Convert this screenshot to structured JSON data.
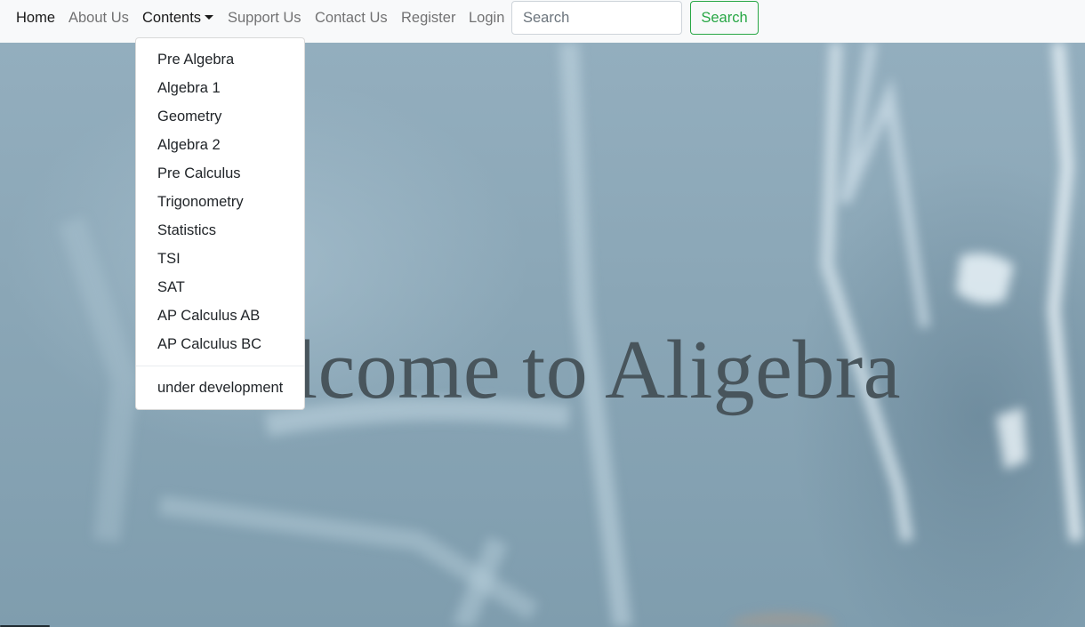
{
  "nav": {
    "links": [
      {
        "label": "Home"
      },
      {
        "label": "About Us"
      },
      {
        "label": "Contents"
      },
      {
        "label": "Support Us"
      },
      {
        "label": "Contact Us"
      },
      {
        "label": "Register"
      },
      {
        "label": "Login"
      }
    ],
    "search": {
      "placeholder": "Search",
      "value": "",
      "button_label": "Search"
    }
  },
  "dropdown": {
    "items": [
      "Pre Algebra",
      "Algebra 1",
      "Geometry",
      "Algebra 2",
      "Pre Calculus",
      "Trigonometry",
      "Statistics",
      "TSI",
      "SAT",
      "AP Calculus AB",
      "AP Calculus BC"
    ],
    "extra_item": "under development"
  },
  "hero": {
    "title": "Welcome to Aligebra"
  },
  "colors": {
    "navbar_bg": "#f8f9fa",
    "search_accent": "#28a745",
    "hero_bg": "#8fa8b6",
    "hero_text": "#48555c"
  }
}
